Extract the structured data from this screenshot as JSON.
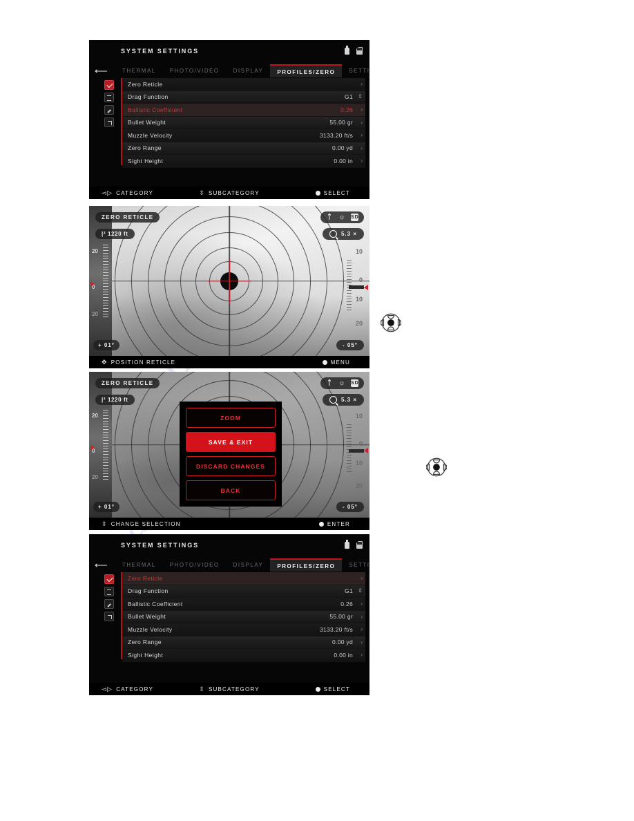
{
  "watermark": {
    "line1": "m.com",
    "line2": "anualslib"
  },
  "panels": {
    "settings_before": {
      "title": "SYSTEM SETTINGS",
      "tabs": [
        {
          "label": "THERMAL",
          "active": false
        },
        {
          "label": "PHOTO/VIDEO",
          "active": false
        },
        {
          "label": "DISPLAY",
          "active": false
        },
        {
          "label": "PROFILES/ZERO",
          "active": true
        },
        {
          "label": "SETTINGS",
          "active": false
        }
      ],
      "rows": [
        {
          "label": "Zero Reticle",
          "value": "",
          "chevron": ">",
          "selected": false,
          "icon": "red-check-icon"
        },
        {
          "label": "Drag Function",
          "value": "G1",
          "chevron": "updown",
          "selected": false,
          "icon": "list-icon"
        },
        {
          "label": "Ballistic Coefficient",
          "value": "0.26",
          "chevron": ">",
          "selected": true,
          "icon": "edit-icon"
        },
        {
          "label": "Bullet Weight",
          "value": "55.00 gr",
          "chevron": ">",
          "selected": false,
          "icon": "external-link-icon"
        },
        {
          "label": "Muzzle Velocity",
          "value": "3133.20 ft/s",
          "chevron": ">",
          "selected": false,
          "icon": ""
        },
        {
          "label": "Zero Range",
          "value": "0.00 yd",
          "chevron": ">",
          "selected": false,
          "icon": ""
        },
        {
          "label": "Sight Height",
          "value": "0.00 in",
          "chevron": ">",
          "selected": false,
          "icon": ""
        }
      ],
      "statusbar": {
        "left": "CATEGORY",
        "center": "SUBCATEGORY",
        "right": "SELECT"
      }
    },
    "reticle_view": {
      "title": "ZERO RETICLE",
      "distance": "1220 ft",
      "zoom": "5.3 ×",
      "inclination": "+ 01°",
      "elevation": "- 05°",
      "left_scale": [
        "20",
        "0",
        "20"
      ],
      "right_scale": [
        "10",
        "0",
        "10",
        "20"
      ],
      "icons": [
        "bluetooth-icon",
        "wifi-off-icon",
        "sd-card-icon",
        "magnifier-icon"
      ],
      "statusbar": {
        "left": "POSITION RETICLE",
        "right": "MENU"
      }
    },
    "reticle_menu": {
      "title": "ZERO RETICLE",
      "distance": "1220 ft",
      "zoom": "5.3 ×",
      "inclination": "+ 01°",
      "elevation": "- 05°",
      "left_scale": [
        "20",
        "0",
        "20"
      ],
      "right_scale": [
        "10",
        "0",
        "10",
        "20"
      ],
      "menu_items": [
        {
          "label": "ZOOM",
          "highlighted": false
        },
        {
          "label": "SAVE & EXIT",
          "highlighted": true
        },
        {
          "label": "DISCARD CHANGES",
          "highlighted": false
        },
        {
          "label": "BACK",
          "highlighted": false
        }
      ],
      "statusbar": {
        "left": "CHANGE SELECTION",
        "right": "ENTER"
      }
    },
    "settings_after": {
      "title": "SYSTEM SETTINGS",
      "tabs": [
        {
          "label": "THERMAL",
          "active": false
        },
        {
          "label": "PHOTO/VIDEO",
          "active": false
        },
        {
          "label": "DISPLAY",
          "active": false
        },
        {
          "label": "PROFILES/ZERO",
          "active": true
        },
        {
          "label": "SETTINGS",
          "active": false
        }
      ],
      "rows": [
        {
          "label": "Zero Reticle",
          "value": "",
          "chevron": ">",
          "selected": true,
          "icon": "red-check-icon"
        },
        {
          "label": "Drag Function",
          "value": "G1",
          "chevron": "updown",
          "selected": false,
          "icon": "list-icon"
        },
        {
          "label": "Ballistic Coefficient",
          "value": "0.26",
          "chevron": ">",
          "selected": false,
          "icon": "edit-icon"
        },
        {
          "label": "Bullet Weight",
          "value": "55.00 gr",
          "chevron": ">",
          "selected": false,
          "icon": "external-link-icon"
        },
        {
          "label": "Muzzle Velocity",
          "value": "3133.20 ft/s",
          "chevron": ">",
          "selected": false,
          "icon": ""
        },
        {
          "label": "Zero Range",
          "value": "0.00 yd",
          "chevron": ">",
          "selected": false,
          "icon": ""
        },
        {
          "label": "Sight Height",
          "value": "0.00 in",
          "chevron": ">",
          "selected": false,
          "icon": ""
        }
      ],
      "statusbar": {
        "left": "CATEGORY",
        "center": "SUBCATEGORY",
        "right": "SELECT"
      }
    }
  },
  "colors": {
    "accent": "#c1121f",
    "selected_text": "#c93b3b",
    "screen_bg": "#060606",
    "highlight": "#d4121a"
  }
}
